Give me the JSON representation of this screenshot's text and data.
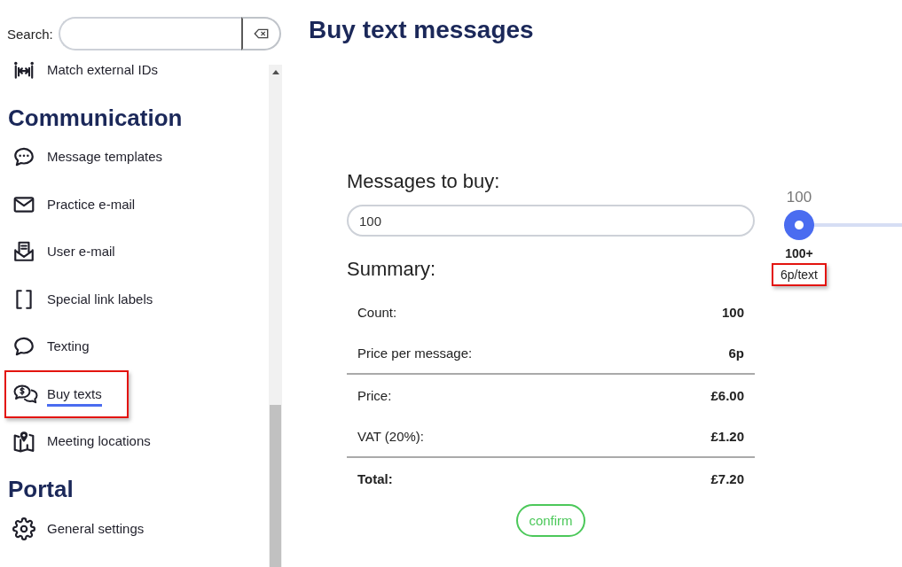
{
  "sidebar": {
    "search": {
      "label": "Search:"
    },
    "sections": [
      {
        "items": [
          {
            "label": "Match external IDs",
            "selected": false,
            "highlighted": false
          }
        ]
      },
      {
        "heading": "Communication",
        "items": [
          {
            "label": "Message templates",
            "selected": false,
            "highlighted": false
          },
          {
            "label": "Practice e-mail",
            "selected": false,
            "highlighted": false
          },
          {
            "label": "User e-mail",
            "selected": false,
            "highlighted": false
          },
          {
            "label": "Special link labels",
            "selected": false,
            "highlighted": false
          },
          {
            "label": "Texting",
            "selected": false,
            "highlighted": false
          },
          {
            "label": "Buy texts",
            "selected": true,
            "highlighted": true
          },
          {
            "label": "Meeting locations",
            "selected": false,
            "highlighted": false
          }
        ]
      },
      {
        "heading": "Portal",
        "items": [
          {
            "label": "General settings",
            "selected": false,
            "highlighted": false
          }
        ]
      }
    ]
  },
  "main": {
    "title": "Buy text messages",
    "quantity": {
      "label": "Messages to buy:",
      "value": "100"
    },
    "slider": {
      "value_label": "100",
      "level": 0,
      "marks": [
        {
          "label": "100+",
          "price": "6p/text",
          "highlighted": true
        }
      ]
    },
    "summary": {
      "title": "Summary:",
      "groups": [
        {
          "rows": [
            {
              "kind": "line",
              "label": "Count:",
              "value": "100"
            },
            {
              "kind": "line",
              "label": "Price per message:",
              "value": "6p"
            }
          ]
        },
        {
          "rows": [
            {
              "kind": "line",
              "label": "Price:",
              "value": "£6.00"
            },
            {
              "kind": "line",
              "label": "VAT (20%):",
              "value": "£1.20"
            }
          ]
        },
        {
          "rows": [
            {
              "kind": "total",
              "label": "Total:",
              "value": "£7.20"
            }
          ]
        }
      ]
    },
    "confirm_button": "confirm"
  }
}
